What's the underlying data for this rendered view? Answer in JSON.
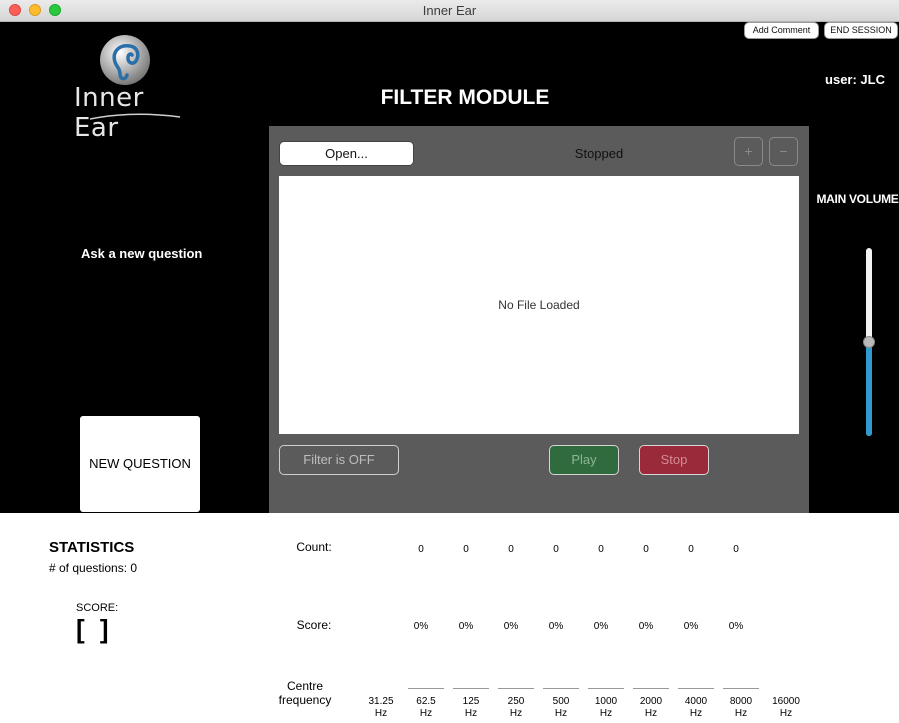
{
  "window": {
    "title": "Inner Ear"
  },
  "header": {
    "add_comment": "Add Comment",
    "end_session": "END SESSION",
    "module_title": "FILTER MODULE",
    "user": "user: JLC",
    "logo_text": "Inner Ear"
  },
  "left": {
    "ask_text": "Ask a new question",
    "new_question": "NEW QUESTION"
  },
  "player": {
    "open_label": "Open...",
    "status": "Stopped",
    "zoom_in": "+",
    "zoom_out": "−",
    "no_file": "No File Loaded",
    "filter_label": "Filter is OFF",
    "play_label": "Play",
    "stop_label": "Stop"
  },
  "volume": {
    "label": "MAIN VOLUME",
    "level": 0.5
  },
  "statistics": {
    "title": "STATISTICS",
    "questions": "# of questions: 0",
    "score_label": "SCORE:",
    "score_value": "[ ]",
    "count_label": "Count:",
    "score_row_label": "Score:",
    "freq_label_1": "Centre",
    "freq_label_2": "frequency",
    "counts": [
      "0",
      "0",
      "0",
      "0",
      "0",
      "0",
      "0",
      "0"
    ],
    "scores": [
      "0%",
      "0%",
      "0%",
      "0%",
      "0%",
      "0%",
      "0%",
      "0%"
    ],
    "frequencies": [
      "31.25",
      "62.5",
      "125",
      "250",
      "500",
      "1000",
      "2000",
      "4000",
      "8000",
      "16000"
    ],
    "freq_unit": "Hz"
  },
  "colors": {
    "volume_fill": "#2e9ad0",
    "play": "#2f6b3c",
    "stop": "#9a2a3a",
    "player_bg": "#5b5b5b"
  }
}
